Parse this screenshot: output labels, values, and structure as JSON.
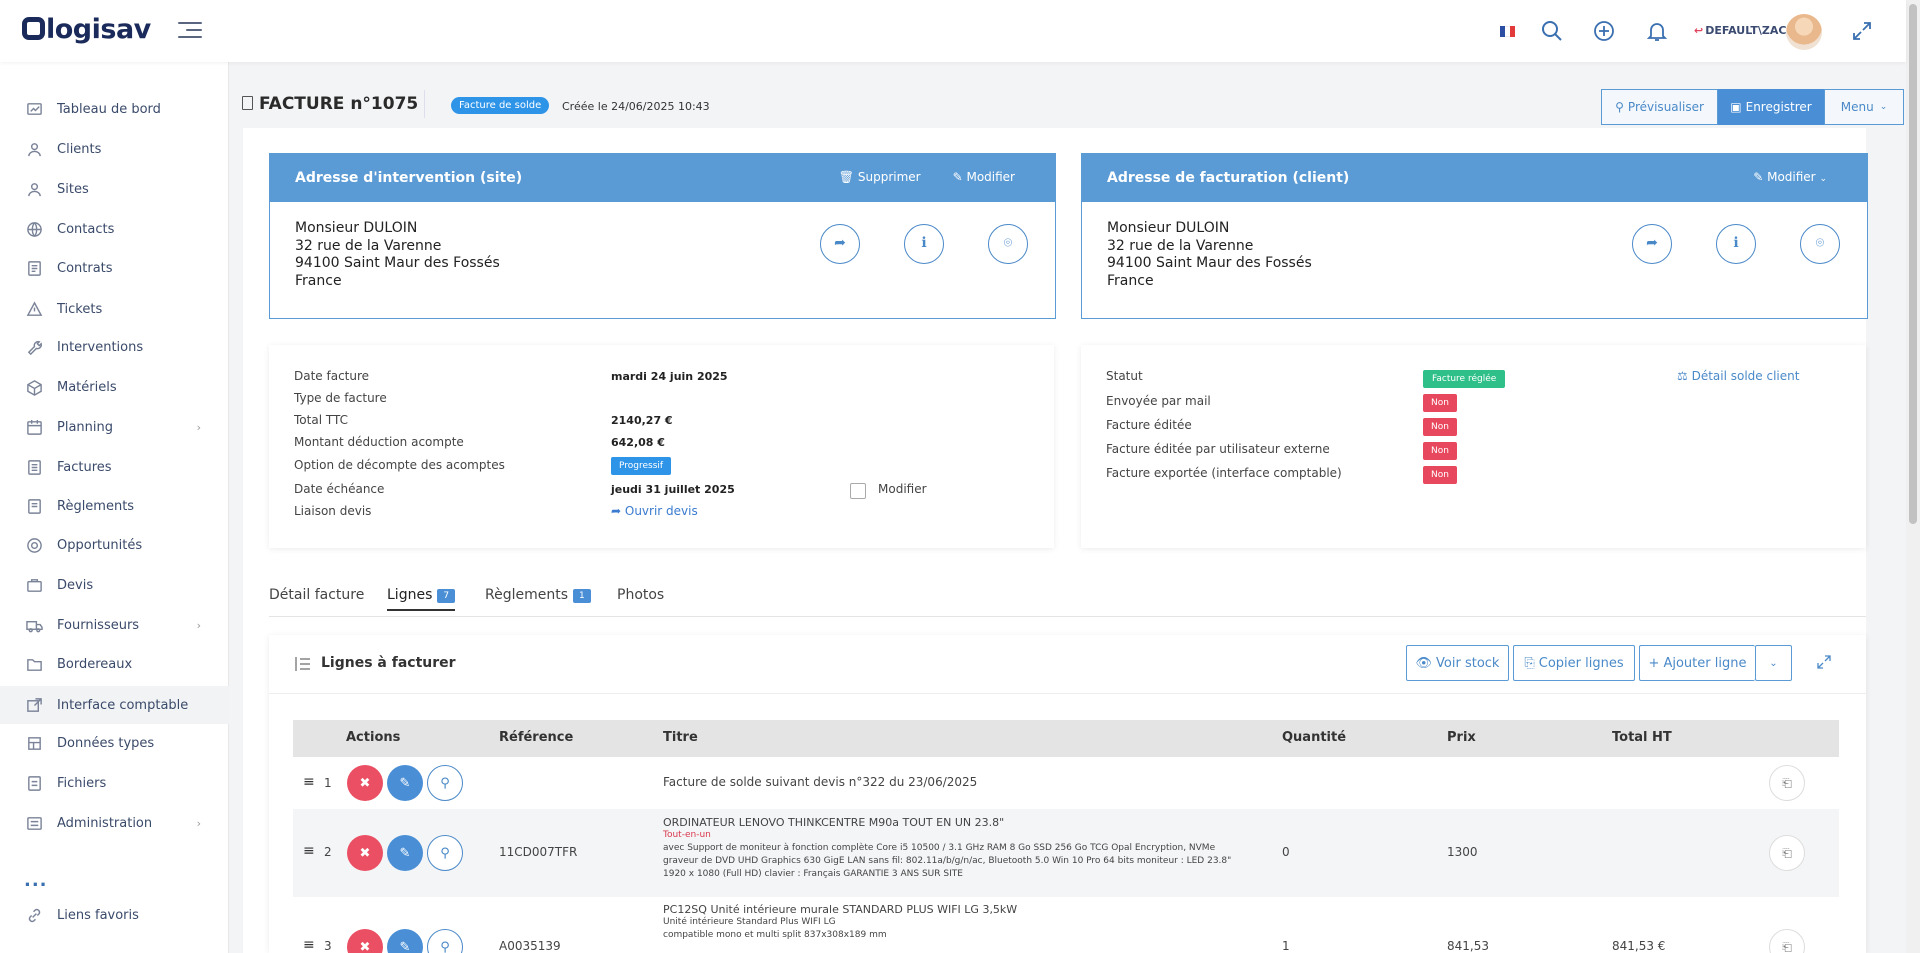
{
  "brand": {
    "logo_text": "logisav"
  },
  "topbar": {
    "user": "DEFAULT\\ZAC",
    "flag_colors": [
      "#2b4ea2",
      "#ffffff",
      "#e23a3a"
    ]
  },
  "sidebar": {
    "items": [
      {
        "label": "Tableau de bord",
        "icon": "dashboard-icon"
      },
      {
        "label": "Clients",
        "icon": "user-icon"
      },
      {
        "label": "Sites",
        "icon": "site-user-icon"
      },
      {
        "label": "Contacts",
        "icon": "globe-icon"
      },
      {
        "label": "Contrats",
        "icon": "contract-icon"
      },
      {
        "label": "Tickets",
        "icon": "warning-icon"
      },
      {
        "label": "Interventions",
        "icon": "wrench-icon"
      },
      {
        "label": "Matériels",
        "icon": "box-icon"
      },
      {
        "label": "Planning",
        "icon": "calendar-icon",
        "chevron": true
      },
      {
        "label": "Factures",
        "icon": "invoice-icon"
      },
      {
        "label": "Règlements",
        "icon": "payment-icon"
      },
      {
        "label": "Opportunités",
        "icon": "target-icon"
      },
      {
        "label": "Devis",
        "icon": "briefcase-icon"
      },
      {
        "label": "Fournisseurs",
        "icon": "truck-icon",
        "chevron": true
      },
      {
        "label": "Bordereaux",
        "icon": "folder-icon"
      },
      {
        "label": "Interface comptable",
        "icon": "external-icon"
      },
      {
        "label": "Données types",
        "icon": "layers-icon"
      },
      {
        "label": "Fichiers",
        "icon": "file-icon"
      },
      {
        "label": "Administration",
        "icon": "admin-icon",
        "chevron": true
      }
    ],
    "more": "...",
    "favorites": "Liens favoris"
  },
  "header": {
    "title": "FACTURE n°1075",
    "type_badge": "Facture de solde",
    "created": "Créée le 24/06/2025 10:43",
    "preview": "Prévisualiser",
    "save": "Enregistrer",
    "menu": "Menu"
  },
  "site_address": {
    "title": "Adresse d'intervention (site)",
    "delete": "Supprimer",
    "edit": "Modifier",
    "lines": [
      "Monsieur DULOIN",
      "32 rue de la Varenne",
      "94100 Saint Maur des Fossés",
      "France"
    ]
  },
  "billing_address": {
    "title": "Adresse de facturation (client)",
    "edit": "Modifier",
    "lines": [
      "Monsieur DULOIN",
      "32 rue de la Varenne",
      "94100 Saint Maur des Fossés",
      "France"
    ]
  },
  "invoice_info": {
    "date_label": "Date facture",
    "date_value": "mardi 24 juin 2025",
    "type_label": "Type de facture",
    "ttc_label": "Total TTC",
    "ttc_value": "2140,27 €",
    "deduction_label": "Montant déduction acompte",
    "deduction_value": "642,08 €",
    "option_label": "Option de décompte des acomptes",
    "option_value": "Progressif",
    "due_label": "Date échéance",
    "due_value": "jeudi 31 juillet 2025",
    "due_modify": "Modifier",
    "quote_label": "Liaison devis",
    "quote_link": "Ouvrir devis"
  },
  "status_info": {
    "status_label": "Statut",
    "status_value": "Facture réglée",
    "balance_link": "Détail solde client",
    "mail_label": "Envoyée par mail",
    "mail_value": "Non",
    "edited_label": "Facture éditée",
    "edited_value": "Non",
    "ext_label": "Facture éditée par utilisateur externe",
    "ext_value": "Non",
    "export_label": "Facture exportée (interface comptable)",
    "export_value": "Non"
  },
  "tabs": [
    {
      "label": "Détail facture"
    },
    {
      "label": "Lignes",
      "count": "7"
    },
    {
      "label": "Règlements",
      "count": "1"
    },
    {
      "label": "Photos"
    }
  ],
  "lines": {
    "title": "Lignes à facturer",
    "stock": "Voir stock",
    "copy": "Copier lignes",
    "add": "Ajouter ligne",
    "columns": [
      "Actions",
      "Référence",
      "Titre",
      "Quantité",
      "Prix",
      "Total HT"
    ],
    "rows": [
      {
        "n": "1",
        "ref": "",
        "title": "Facture de solde suivant devis n°322 du 23/06/2025",
        "qty": "",
        "price": "",
        "total": ""
      },
      {
        "n": "2",
        "ref": "11CD007TFR",
        "title": "ORDINATEUR LENOVO THINKCENTRE M90a TOUT EN UN 23.8\"",
        "tag": "Tout-en-un",
        "desc": "avec Support de moniteur à fonction complète Core i5 10500 / 3.1 GHz RAM 8 Go SSD 256 Go TCG Opal Encryption, NVMe graveur de DVD UHD Graphics 630 GigE LAN sans fil: 802.11a/b/g/n/ac, Bluetooth 5.0 Win 10 Pro 64 bits moniteur : LED 23.8\" 1920 x 1080 (Full HD) clavier : Français GARANTIE 3 ANS SUR SITE",
        "qty": "0",
        "price": "1300",
        "total": ""
      },
      {
        "n": "3",
        "ref": "A0035139",
        "title": "PC12SQ Unité intérieure murale STANDARD PLUS WIFI LG 3,5kW",
        "desc1": "Unité intérieure Standard Plus WIFI LG",
        "desc2": "compatible mono et multi split 837x308x189 mm",
        "qty": "1",
        "price": "841,53",
        "total": "841,53 €"
      }
    ]
  }
}
